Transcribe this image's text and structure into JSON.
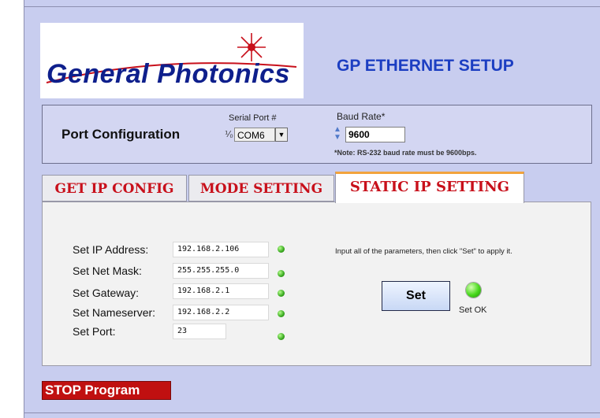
{
  "logo": {
    "text": "General Photonics"
  },
  "page_title": "GP ETHERNET SETUP",
  "port_config": {
    "heading": "Port Configuration",
    "serial_port_label": "Serial Port #",
    "serial_port_io_glyph": "⅟₀",
    "serial_port_value": "COM6",
    "baud_rate_label": "Baud Rate*",
    "baud_rate_value": "9600",
    "baud_note": "*Note: RS-232 baud rate must be 9600bps."
  },
  "tabs": [
    {
      "label": "GET IP CONFIG",
      "active": false
    },
    {
      "label": "MODE SETTING",
      "active": false
    },
    {
      "label": "STATIC IP SETTING",
      "active": true
    }
  ],
  "static_ip": {
    "rows": [
      {
        "label": "Set IP Address:",
        "value": "192.168.2.106"
      },
      {
        "label": "Set Net Mask:",
        "value": "255.255.255.0"
      },
      {
        "label": "Set Gateway:",
        "value": "192.168.2.1"
      },
      {
        "label": "Set Nameserver:",
        "value": "192.168.2.2"
      },
      {
        "label": "Set Port:",
        "value": "23"
      }
    ],
    "instruction": "Input all of the parameters, then click \"Set\" to apply it.",
    "set_button_label": "Set",
    "status_label": "Set OK"
  },
  "stop_button_label": "STOP Program",
  "colors": {
    "background": "#c8cdef",
    "title_blue": "#1c3ec2",
    "tab_text_red": "#c8101b",
    "stop_red": "#c01010",
    "led_green": "#38a81f"
  }
}
